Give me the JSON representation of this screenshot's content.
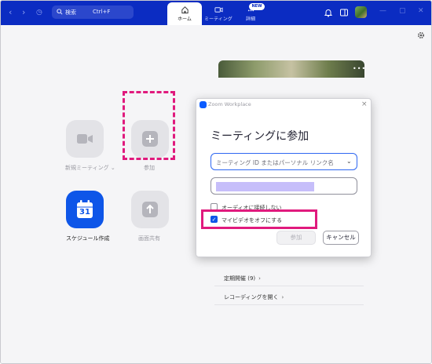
{
  "titlebar": {
    "search_label": "検索",
    "search_shortcut": "Ctrl+F",
    "tabs": [
      {
        "label": "ホーム",
        "icon": "home-icon"
      },
      {
        "label": "ミーティング",
        "icon": "video-camera-icon"
      },
      {
        "label": "詳細",
        "icon": "more-dots-icon"
      }
    ],
    "new_badge": "NEW",
    "accent": "#0b2cc2"
  },
  "home": {
    "tiles": [
      {
        "label": "新規ミーティング",
        "icon": "video-camera-icon"
      },
      {
        "label": "参加",
        "icon": "plus-icon"
      },
      {
        "label": "スケジュール作成",
        "icon": "calendar-icon",
        "calendar_day": "31"
      },
      {
        "label": "画面共有",
        "icon": "share-arrow-up-icon"
      }
    ],
    "list": [
      {
        "label": "定期開催 (9)"
      },
      {
        "label": "レコーディングを開く"
      }
    ]
  },
  "dialog": {
    "window_title": "Zoom Workplace",
    "heading": "ミーティングに参加",
    "meeting_id_placeholder": "ミーティング ID またはパーソナル リンク名",
    "name_value": "",
    "no_audio_label": "オーディオに接続しない",
    "no_audio_checked": false,
    "video_off_label": "マイビデオをオフにする",
    "video_off_checked": true,
    "join_button": "参加",
    "cancel_button": "キャンセル"
  },
  "colors": {
    "annotation_highlight": "#e01a7d",
    "primary_blue": "#0e56e8"
  }
}
